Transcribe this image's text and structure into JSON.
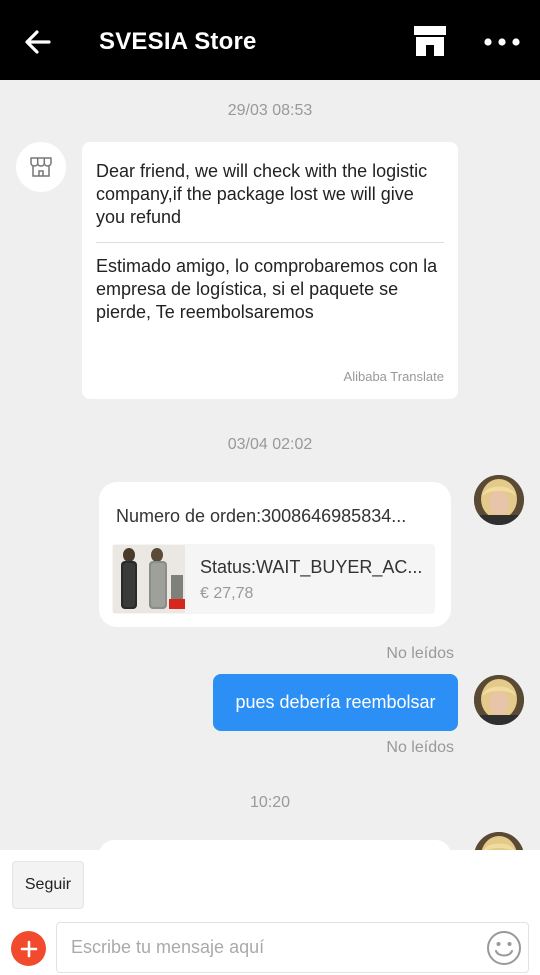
{
  "header": {
    "title": "SVESIA Store"
  },
  "messages": {
    "timestamp_1": "29/03 08:53",
    "store_message": {
      "original": "Dear friend, we will check with the logistic company,if the package lost we will give you refund",
      "translated": "Estimado amigo, lo comprobaremos con la empresa de logística, si el paquete se pierde, Te reembolsaremos",
      "translate_label": "Alibaba Translate"
    },
    "timestamp_2": "03/04 02:02",
    "order_card": {
      "order_number": "Numero de orden:3008646985834...",
      "status": "Status:WAIT_BUYER_AC...",
      "price": "€ 27,78"
    },
    "read_status_1": "No leídos",
    "user_message": "pues debería reembolsar",
    "read_status_2": "No leídos",
    "timestamp_3": "10:20"
  },
  "bottom_bar": {
    "follow_label": "Seguir",
    "input_placeholder": "Escribe tu mensaje aquí",
    "input_value": ""
  },
  "colors": {
    "header_bg": "#000000",
    "outgoing_bubble": "#2b8ff5",
    "plus_button": "#f24a2d",
    "chat_bg": "#efefef"
  },
  "icons": [
    "back-arrow-icon",
    "store-icon",
    "more-options-icon",
    "store-avatar-icon",
    "add-icon",
    "emoji-icon"
  ]
}
